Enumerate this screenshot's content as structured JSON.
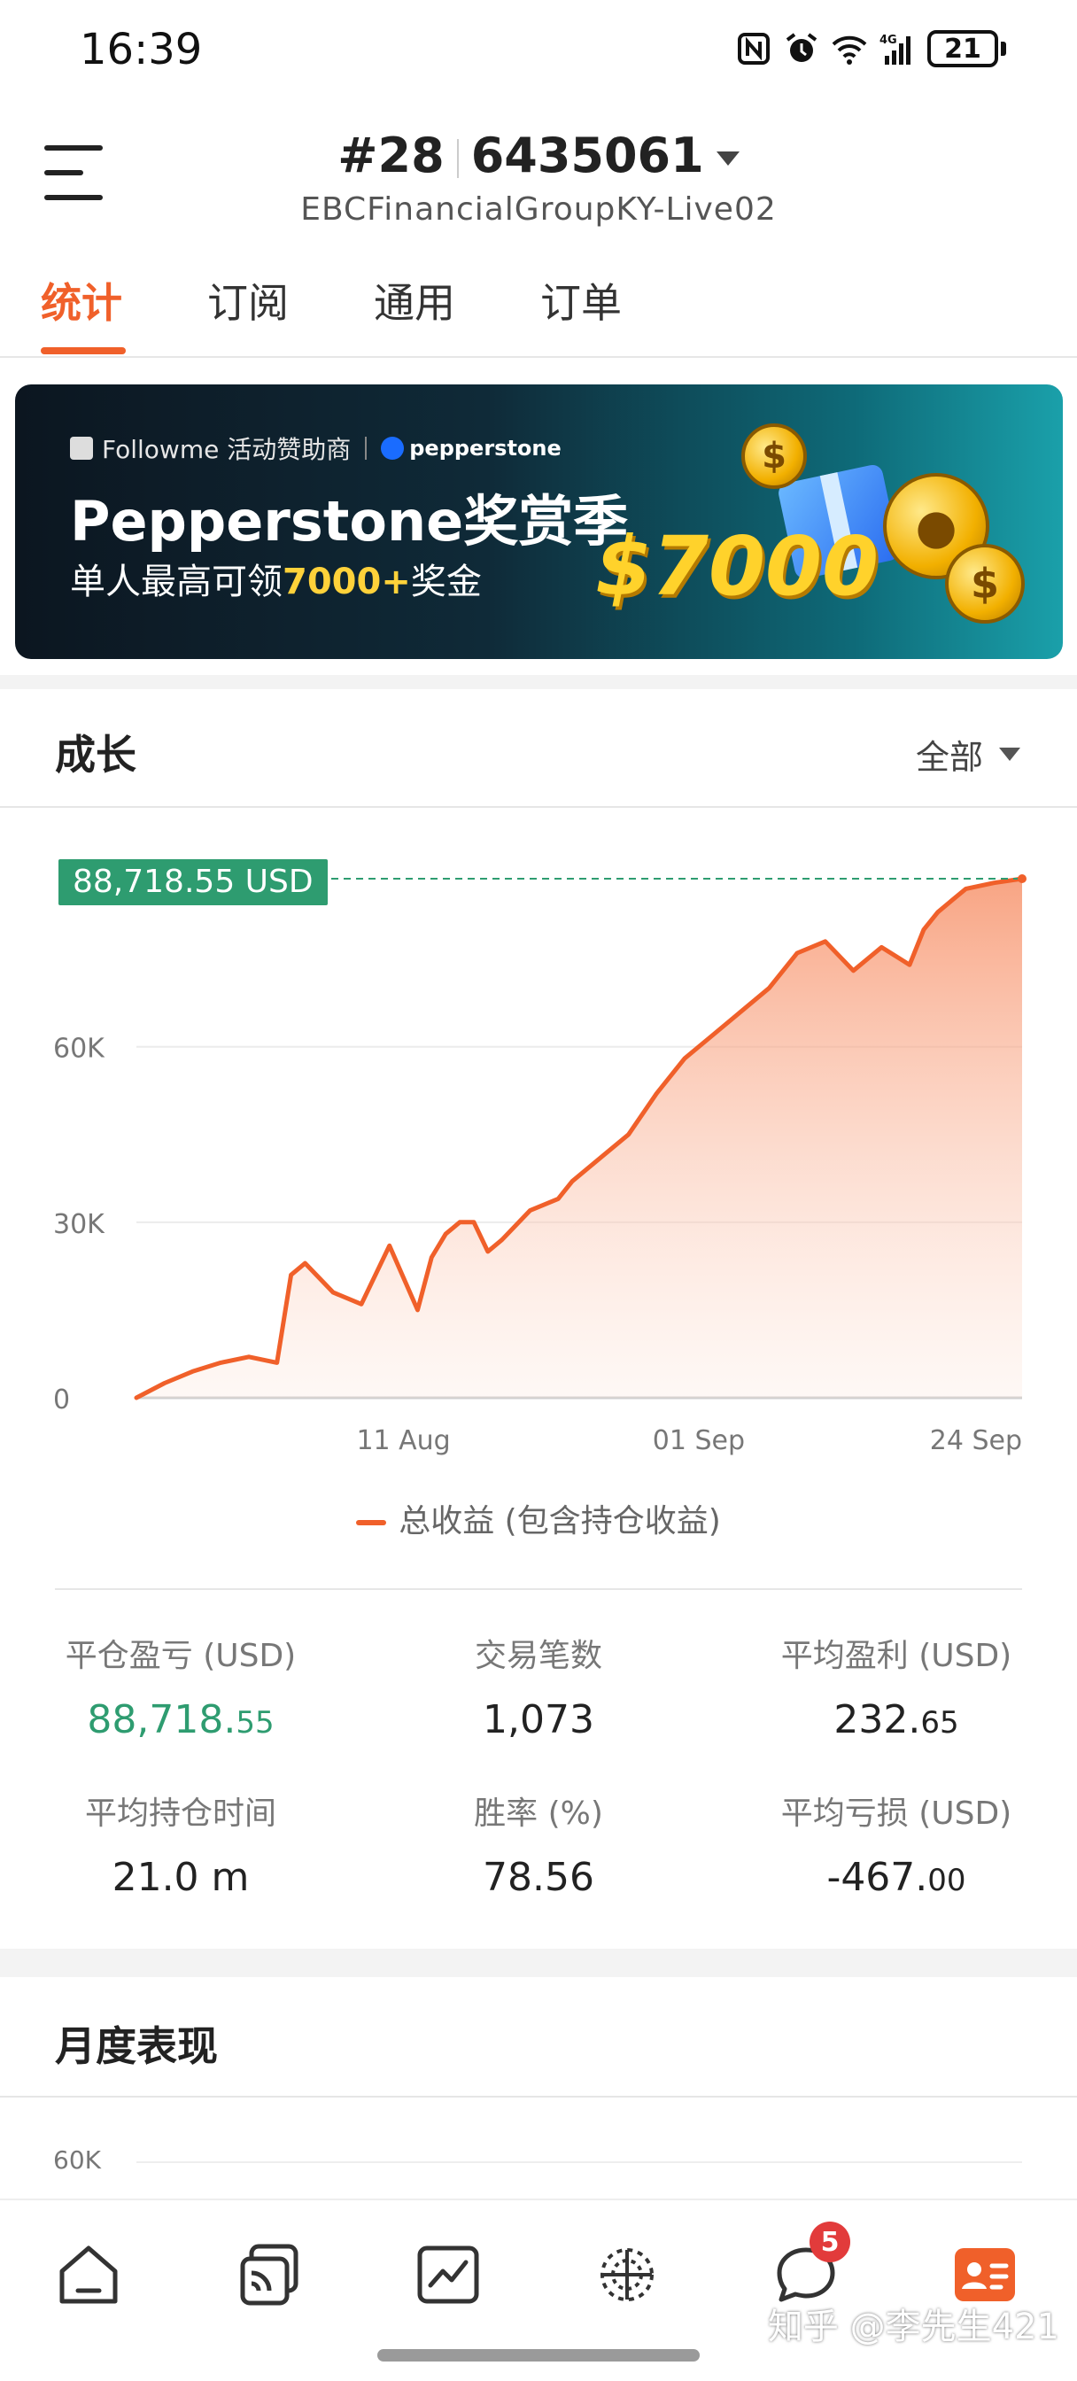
{
  "status_bar": {
    "time": "16:39",
    "network": "4G",
    "battery": "21"
  },
  "header": {
    "rank": "#28",
    "account_id": "6435061",
    "server": "EBCFinancialGroupKY-Live02"
  },
  "tabs": [
    {
      "label": "统计",
      "active": true
    },
    {
      "label": "订阅",
      "active": false
    },
    {
      "label": "通用",
      "active": false
    },
    {
      "label": "订单",
      "active": false
    }
  ],
  "banner": {
    "sponsor_line": "Followme 活动赞助商",
    "brand": "pepperstone",
    "title": "Pepperstone奖赏季",
    "subtitle_prefix": "单人最高可领",
    "subtitle_amount": "7000+",
    "subtitle_suffix": "奖金",
    "big_amount": "$7000"
  },
  "growth": {
    "title": "成长",
    "range": "全部"
  },
  "chart_data": {
    "type": "area",
    "title": "",
    "xlabel": "",
    "ylabel": "",
    "x_ticks": [
      "11 Aug",
      "01 Sep",
      "24 Sep"
    ],
    "y_ticks": [
      "0",
      "30K",
      "60K"
    ],
    "ylim": [
      0,
      88718.55
    ],
    "xlim": [
      "2024-07-23",
      "2024-09-24"
    ],
    "current_value_label": "88,718.55 USD",
    "series": [
      {
        "name": "总收益 (包含持仓收益)",
        "color": "#f0602a",
        "x": [
          "2024-07-23",
          "2024-07-25",
          "2024-07-27",
          "2024-07-29",
          "2024-07-31",
          "2024-08-02",
          "2024-08-03",
          "2024-08-04",
          "2024-08-06",
          "2024-08-08",
          "2024-08-10",
          "2024-08-12",
          "2024-08-13",
          "2024-08-14",
          "2024-08-15",
          "2024-08-16",
          "2024-08-17",
          "2024-08-18",
          "2024-08-20",
          "2024-08-22",
          "2024-08-23",
          "2024-08-25",
          "2024-08-27",
          "2024-08-29",
          "2024-08-31",
          "2024-09-02",
          "2024-09-04",
          "2024-09-06",
          "2024-09-08",
          "2024-09-10",
          "2024-09-12",
          "2024-09-14",
          "2024-09-16",
          "2024-09-17",
          "2024-09-18",
          "2024-09-19",
          "2024-09-20",
          "2024-09-22",
          "2024-09-24"
        ],
        "values": [
          0,
          2500,
          4500,
          6000,
          7000,
          6000,
          21000,
          23000,
          18000,
          16000,
          26000,
          15000,
          24000,
          28000,
          30000,
          30000,
          25000,
          27000,
          32000,
          34000,
          37000,
          41000,
          45000,
          52000,
          58000,
          62000,
          66000,
          70000,
          76000,
          78000,
          73000,
          77000,
          74000,
          80000,
          83000,
          85000,
          87000,
          88000,
          88718.55
        ]
      }
    ]
  },
  "stats": [
    {
      "label": "平仓盈亏 (USD)",
      "int": "88,718.",
      "dec": "55",
      "color": "green"
    },
    {
      "label": "交易笔数",
      "int": "1,073",
      "dec": "",
      "color": "default"
    },
    {
      "label": "平均盈利 (USD)",
      "int": "232.",
      "dec": "65",
      "color": "default"
    },
    {
      "label": "平均持仓时间",
      "int": "21.0 m",
      "dec": "",
      "color": "default"
    },
    {
      "label": "胜率 (%)",
      "int": "78.56",
      "dec": "",
      "color": "default"
    },
    {
      "label": "平均亏损 (USD)",
      "int": "-467.",
      "dec": "00",
      "color": "default"
    }
  ],
  "monthly": {
    "title": "月度表现",
    "axis_top": "60K"
  },
  "bottom_nav": {
    "items": [
      {
        "icon": "home-icon"
      },
      {
        "icon": "copy-trade-icon"
      },
      {
        "icon": "chart-icon"
      },
      {
        "icon": "discover-icon"
      },
      {
        "icon": "chat-icon",
        "badge": "5"
      },
      {
        "icon": "profile-card-icon",
        "active": true
      }
    ],
    "accent": "#f0602a"
  },
  "watermark": "知乎 @李先生421"
}
